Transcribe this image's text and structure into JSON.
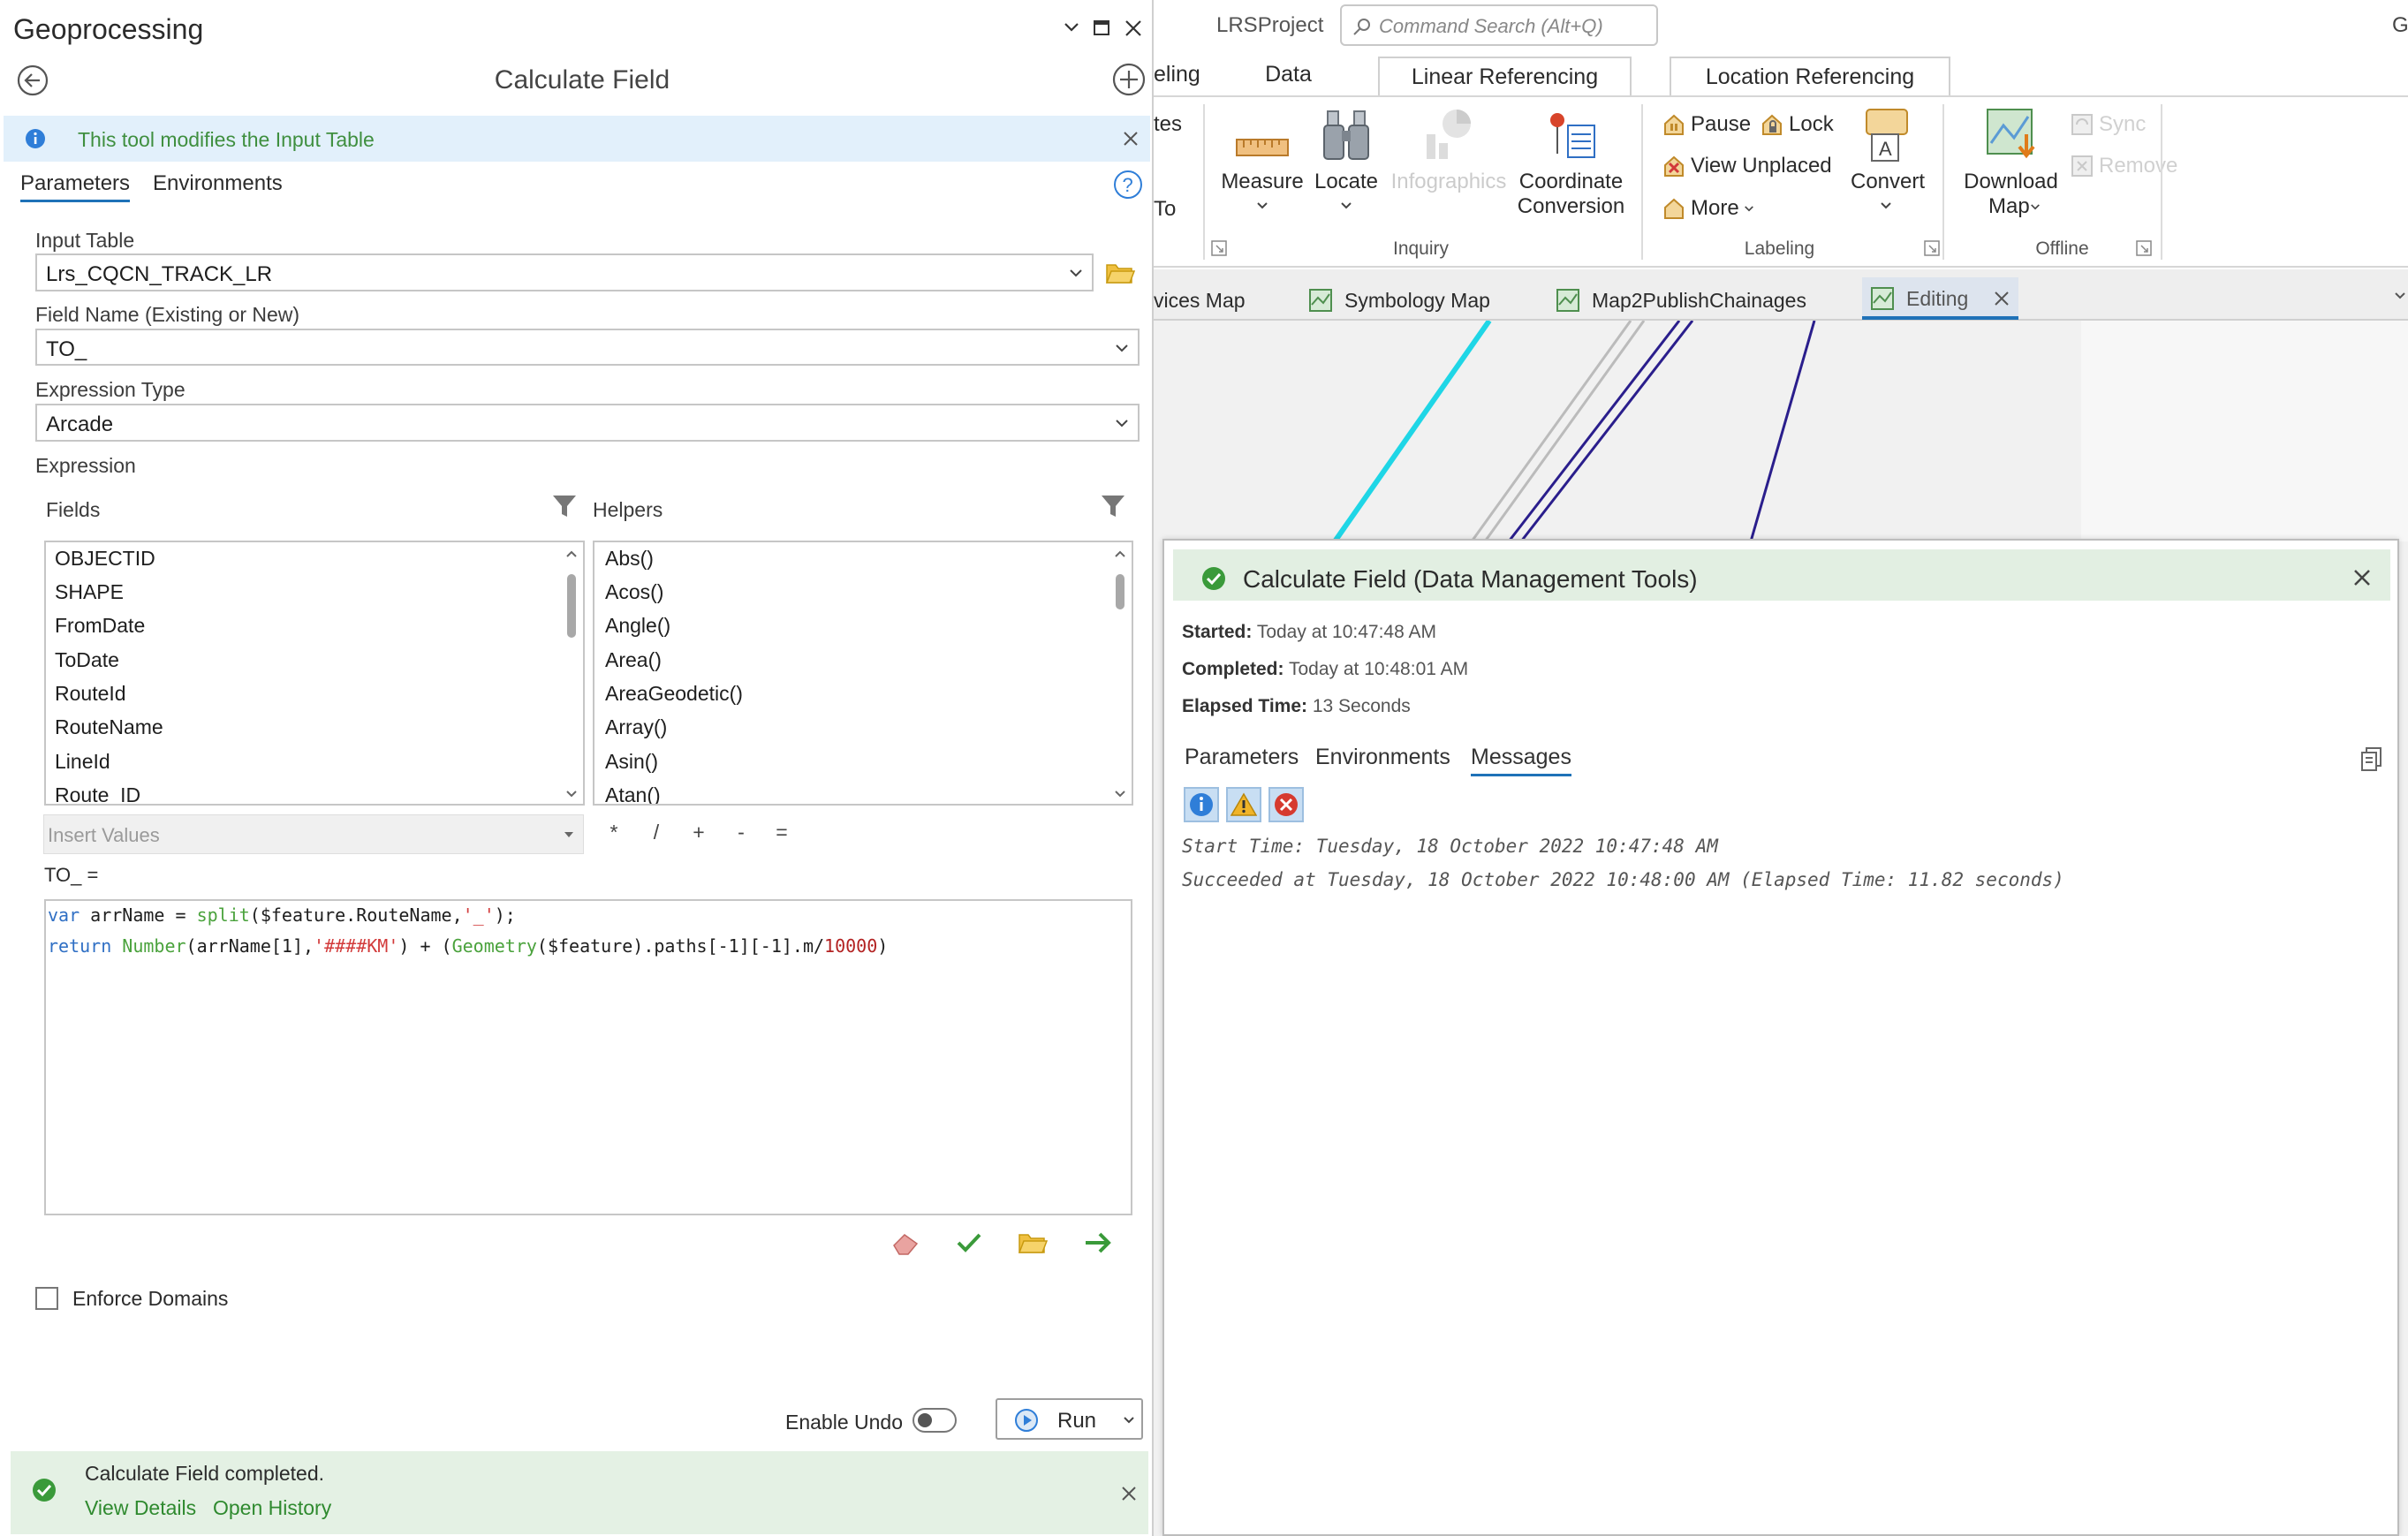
{
  "gp": {
    "pane_title": "Geoprocessing",
    "tool_title": "Calculate Field",
    "banner_text": "This tool modifies the Input Table",
    "tabs": [
      "Parameters",
      "Environments"
    ],
    "input_table_label": "Input Table",
    "input_table_value": "Lrs_CQCN_TRACK_LR",
    "field_name_label": "Field Name (Existing or New)",
    "field_name_value": "TO_",
    "expression_type_label": "Expression Type",
    "expression_type_value": "Arcade",
    "expression_label": "Expression",
    "fields_label": "Fields",
    "helpers_label": "Helpers",
    "fields": [
      "OBJECTID",
      "SHAPE",
      "FromDate",
      "ToDate",
      "RouteId",
      "RouteName",
      "LineId",
      "Route_ID"
    ],
    "helpers": [
      "Abs()",
      "Acos()",
      "Angle()",
      "Area()",
      "AreaGeodetic()",
      "Array()",
      "Asin()",
      "Atan()"
    ],
    "insert_values_label": "Insert Values",
    "operators": [
      "*",
      "/",
      "+",
      "-",
      "="
    ],
    "expression_target": "TO_ =",
    "code": {
      "line1": {
        "kw": "var",
        "a": " arrName = ",
        "fn": "split",
        "b": "($feature.RouteName,",
        "str": "'_'",
        "c": ");"
      },
      "line2": {
        "kw": "return",
        "fn1": " Number",
        "a": "(arrName[1],",
        "str": "'####KM'",
        "b": ") + (",
        "fn2": "Geometry",
        "c": "($feature).paths[-1][-1].m/",
        "num": "10000",
        "d": ")"
      }
    },
    "enforce_domains_label": "Enforce Domains",
    "enable_undo_label": "Enable Undo",
    "run_label": "Run",
    "status_text": "Calculate Field completed.",
    "view_details": "View Details",
    "open_history": "Open History"
  },
  "app": {
    "project_name": "LRSProject",
    "search_placeholder": "Command Search (Alt+Q)",
    "user_initial": "G",
    "ribbon_tabs": [
      "eling",
      "Data",
      "Linear Referencing",
      "Location Referencing"
    ],
    "ribbon_partial": [
      "tes",
      "To"
    ],
    "inquiry": {
      "measure": "Measure",
      "locate": "Locate",
      "infographics": "Infographics",
      "coord1": "Coordinate",
      "coord2": "Conversion",
      "group": "Inquiry"
    },
    "labeling": {
      "pause": "Pause",
      "lock": "Lock",
      "view_unplaced": "View Unplaced",
      "more": "More",
      "convert": "Convert",
      "group": "Labeling"
    },
    "offline": {
      "download1": "Download",
      "download2": "Map",
      "sync": "Sync",
      "remove": "Remove",
      "group": "Offline"
    },
    "map_tabs": [
      "vices Map",
      "Symbology Map",
      "Map2PublishChainages",
      "Editing"
    ]
  },
  "details": {
    "title": "Calculate Field (Data Management Tools)",
    "started_label": "Started:",
    "started_value": "Today at 10:47:48 AM",
    "completed_label": "Completed:",
    "completed_value": "Today at 10:48:01 AM",
    "elapsed_label": "Elapsed Time:",
    "elapsed_value": "13 Seconds",
    "tabs": [
      "Parameters",
      "Environments",
      "Messages"
    ],
    "messages": [
      "Start Time: Tuesday, 18 October 2022 10:47:48 AM",
      "Succeeded at Tuesday, 18 October 2022 10:48:00 AM (Elapsed Time: 11.82 seconds)"
    ]
  },
  "colors": {
    "accent": "#1f72b8",
    "success": "#3a9a3a",
    "info_banner": "#e2f0fb",
    "status_bar": "#e4f1e4"
  }
}
